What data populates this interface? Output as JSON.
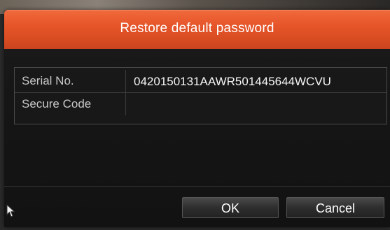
{
  "dialog": {
    "title": "Restore default password"
  },
  "form": {
    "serial": {
      "label": "Serial No.",
      "value": "0420150131AAWR501445644WCVU"
    },
    "secure_code": {
      "label": "Secure Code",
      "value": ""
    }
  },
  "buttons": {
    "ok_label": "OK",
    "cancel_label": "Cancel"
  },
  "colors": {
    "title_bar": "#e6552a",
    "dialog_bg": "#161616",
    "text": "#ffffff"
  },
  "icons": {
    "cursor": "mouse-pointer-icon"
  }
}
